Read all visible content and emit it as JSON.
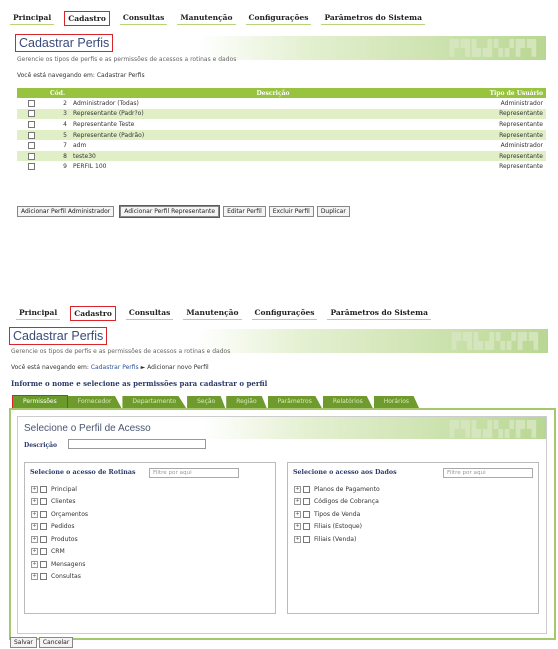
{
  "top": {
    "nav": [
      "Principal",
      "Cadastro",
      "Consultas",
      "Manutenção",
      "Configurações",
      "Parâmetros do Sistema"
    ],
    "title": "Cadastrar Perfis",
    "subtitle": "Gerencie os tipos de perfis e as permissões de acessos a rotinas e dados",
    "crumb_prefix": "Você está navegando em:",
    "crumb": "Cadastrar Perfis",
    "table": {
      "headers": [
        "Cód.",
        "Descrição",
        "Tipo de Usuário"
      ],
      "rows": [
        {
          "cod": "2",
          "desc": "Administrador (Todas)",
          "tipo": "Administrador"
        },
        {
          "cod": "3",
          "desc": "Representante (Padr?o)",
          "tipo": "Representante"
        },
        {
          "cod": "4",
          "desc": "Representante Teste",
          "tipo": "Representante"
        },
        {
          "cod": "5",
          "desc": "Representante (Padrão)",
          "tipo": "Representante"
        },
        {
          "cod": "7",
          "desc": "adm",
          "tipo": "Administrador"
        },
        {
          "cod": "8",
          "desc": "teste30",
          "tipo": "Representante"
        },
        {
          "cod": "9",
          "desc": "PERFIL 100",
          "tipo": "Representante"
        }
      ]
    },
    "buttons": [
      "Adicionar Perfil Administrador",
      "Adicionar Perfil Representante",
      "Editar Perfil",
      "Excluir Perfil",
      "Duplicar"
    ]
  },
  "bottom": {
    "nav": [
      "Principal",
      "Cadastro",
      "Consultas",
      "Manutenção",
      "Configurações",
      "Parâmetros do Sistema"
    ],
    "title": "Cadastrar Perfis",
    "subtitle": "Gerencie os tipos de perfis e as permissões de acessos a rotinas e dados",
    "crumb_prefix": "Você está navegando em:",
    "crumb_link": "Cadastrar Perfis",
    "crumb_arrow": "►",
    "crumb_current": "Adicionar novo Perfil",
    "instruction": "Informe o nome e selecione as permissões para cadastrar o perfil",
    "tabs": [
      "Permissões",
      "Fornecedor",
      "Departamento",
      "Seção",
      "Região",
      "Parâmetros",
      "Relatórios",
      "Horários"
    ],
    "inner_title": "Selecione o Perfil de Acesso",
    "descricao_label": "Descrição",
    "rotinas": {
      "title": "Selecione o acesso de Rotinas",
      "filter_placeholder": "Filtre por aqui",
      "items": [
        "Principal",
        "Clientes",
        "Orçamentos",
        "Pedidos",
        "Produtos",
        "CRM",
        "Mensagens",
        "Consultas"
      ]
    },
    "dados": {
      "title": "Selecione o acesso aos Dados",
      "filter_placeholder": "Filtre por aqui",
      "items": [
        "Planos de Pagamento",
        "Códigos de Cobrança",
        "Tipos de Venda",
        "Filiais (Estoque)",
        "Filiais (Venda)"
      ]
    },
    "buttons": [
      "Salvar",
      "Cancelar"
    ]
  },
  "colors": {
    "accent_green": "#97c33e",
    "tab_green": "#6f9a2e",
    "highlight_red": "#d9252a"
  }
}
